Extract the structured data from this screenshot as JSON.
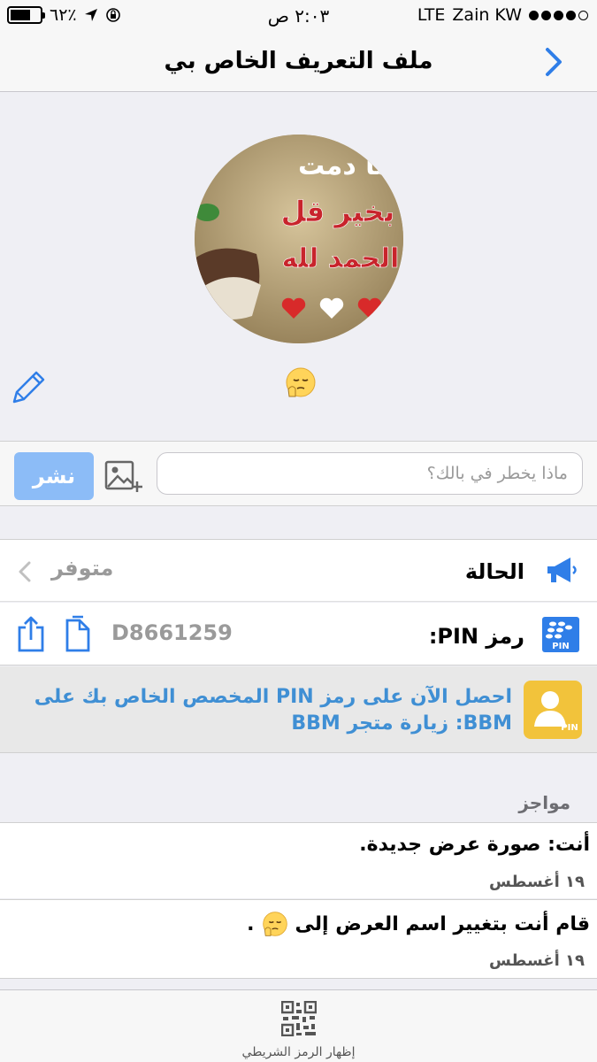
{
  "status_bar": {
    "battery": "٦٢٪",
    "time": "٢:٠٣ ص",
    "network": "LTE",
    "carrier": "Zain KW"
  },
  "nav": {
    "title": "ملف التعريف الخاص بي",
    "back_icon": "chevron-right-icon"
  },
  "profile": {
    "avatar_text": [
      "ما دمت",
      "بخير قل",
      "الحمد لله"
    ],
    "status_emoji": "😔",
    "edit_icon": "pencil-icon"
  },
  "post": {
    "placeholder": "ماذا يخطر في بالك؟",
    "button_label": "نشر",
    "image_icon": "add-image-icon"
  },
  "status_row": {
    "label": "الحالة",
    "value": "متوفر",
    "icon": "megaphone-icon"
  },
  "pin_row": {
    "label": "رمز PIN:",
    "value": "D8661259",
    "icon": "bbm-pin-icon",
    "copy_icon": "copy-icon",
    "share_icon": "share-icon"
  },
  "promo": {
    "text": "احصل الآن على رمز PIN المخصص الخاص بك على BBM: زيارة متجر BBM",
    "icon_badge": "PIN"
  },
  "feed": {
    "title": "مواجز",
    "items": [
      {
        "text": "أنت: صورة عرض جديدة.",
        "date": "١٩ أغسطس"
      },
      {
        "text": "قام أنت بتغيير اسم العرض إلى",
        "emoji": "😔.",
        "date": "١٩ أغسطس"
      }
    ]
  },
  "tabbar": {
    "label": "إظهار الرمز الشريطي",
    "icon": "qr-code-icon"
  },
  "colors": {
    "accent": "#2f7ee8",
    "button_disabled": "#8cbcf7",
    "promo_text": "#3f8fd4",
    "promo_icon_bg": "#f2c33b"
  }
}
